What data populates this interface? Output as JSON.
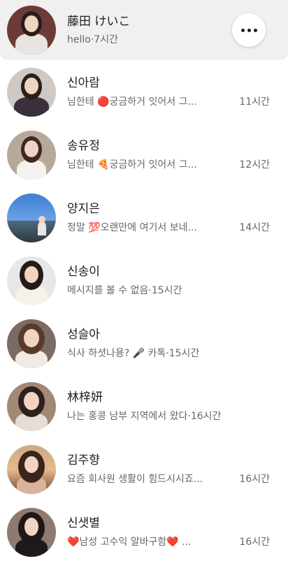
{
  "conversations": [
    {
      "name": "藤田 けいこ",
      "preview": "hello",
      "time": "7시간",
      "active": true
    },
    {
      "name": "신아람",
      "preview": "님한테 🔴궁금하거 잇어서 그...",
      "time": "11시간"
    },
    {
      "name": "송유정",
      "preview": "님한테 🍕궁금하거 잇어서 그...",
      "time": "12시간"
    },
    {
      "name": "양지은",
      "preview": "정말 💯오랜만에 여기서 보네...",
      "time": "14시간"
    },
    {
      "name": "신송이",
      "preview": "메시지를 볼 수 없음",
      "time": "15시간"
    },
    {
      "name": "성슬아",
      "preview": "식사 하셧나용? 🎤 카톡",
      "time": "15시간"
    },
    {
      "name": "林梓妍",
      "preview": "나는 홍콩 남부 지역에서 왔다",
      "time": "16시간"
    },
    {
      "name": "김주향",
      "preview": "요즘 회사원 생활이 힘드시시죠...",
      "time": "16시간"
    },
    {
      "name": "신샛별",
      "preview": "❤️남성 고수익 알바구함❤️ ...",
      "time": "16시간"
    }
  ],
  "separator": "·",
  "colors": {
    "active_bg": "#f0f0f0",
    "text_primary": "#1c1e21",
    "text_secondary": "#65676b"
  }
}
